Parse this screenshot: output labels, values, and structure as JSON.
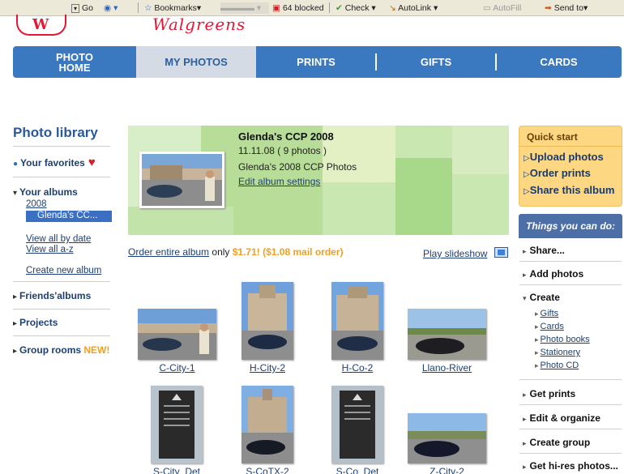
{
  "toolbar": {
    "go": "Go",
    "bookmarks": "Bookmarks",
    "blocked": "64 blocked",
    "check": "Check",
    "autolink": "AutoLink",
    "autofill": "AutoFill",
    "send_to": "Send to"
  },
  "brand": {
    "script": "Walgreens"
  },
  "nav": [
    {
      "label": "PHOTO\nHOME"
    },
    {
      "label": "MY PHOTOS"
    },
    {
      "label": "PRINTS"
    },
    {
      "label": "GIFTS"
    },
    {
      "label": "CARDS"
    }
  ],
  "sidebar": {
    "title": "Photo library",
    "favorites": "Your favorites",
    "albums": "Your albums",
    "year": "2008",
    "selected_album": "Glenda's CC...",
    "view_by_date": "View all by date",
    "view_az": "View all a-z",
    "create_album": "Create new album",
    "friends": "Friends'albums",
    "projects": "Projects",
    "group_rooms": "Group rooms",
    "new_tag": "NEW!"
  },
  "album": {
    "title": "Glenda's CCP 2008",
    "meta": "11.11.08 ( 9 photos )",
    "description": "Glenda's 2008 CCP Photos",
    "edit": "Edit album settings"
  },
  "order": {
    "link": "Order entire album",
    "only": "only",
    "price": "$1.71! ($1.08 mail order)",
    "slideshow": "Play slideshow"
  },
  "photos": [
    {
      "caption": "C-City-1"
    },
    {
      "caption": "H-City-2"
    },
    {
      "caption": "H-Co-2"
    },
    {
      "caption": "Llano-River"
    },
    {
      "caption": "S-City_Det"
    },
    {
      "caption": "S-CoTX-2"
    },
    {
      "caption": "S-Co_Det"
    },
    {
      "caption": "Z-City-2"
    }
  ],
  "quick_start": {
    "title": "Quick start",
    "upload": "Upload photos",
    "order": "Order prints",
    "share": "Share this album"
  },
  "things": {
    "title": "Things you can do:",
    "share": "Share...",
    "add_photos": "Add photos",
    "create": "Create",
    "create_items": [
      "Gifts",
      "Cards",
      "Photo books",
      "Stationery",
      "Photo CD"
    ],
    "get_prints": "Get prints",
    "edit_organize": "Edit & organize",
    "create_group": "Create group",
    "hi_res": "Get hi-res photos..."
  }
}
